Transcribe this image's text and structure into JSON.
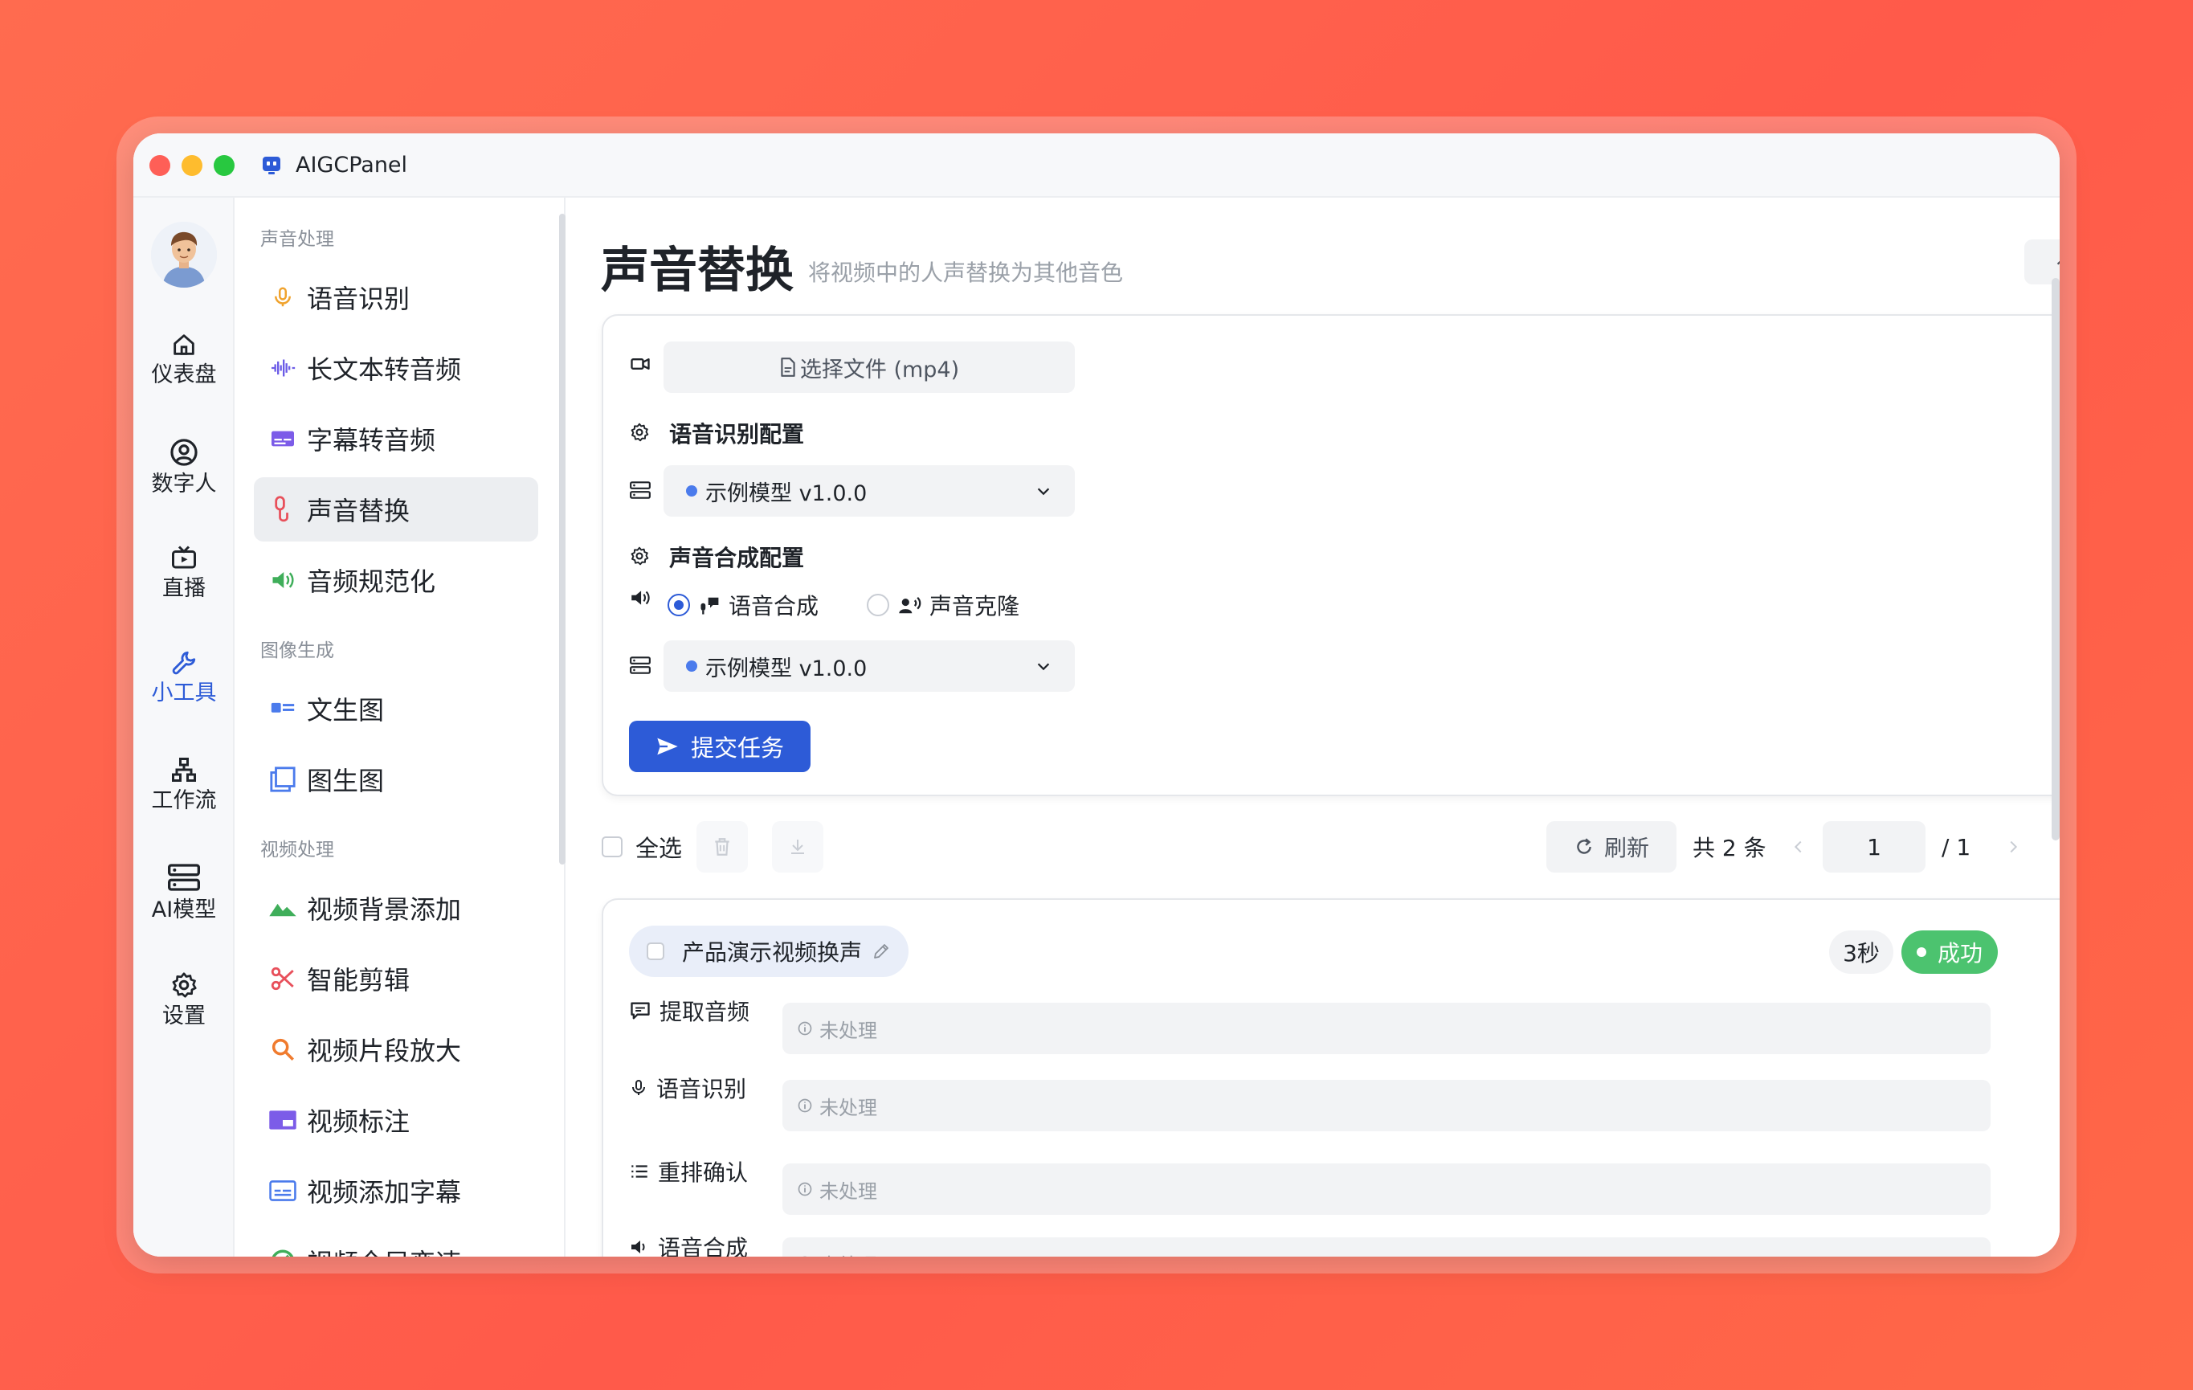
{
  "window": {
    "title": "AIGCPanel"
  },
  "leftnav": {
    "items": [
      {
        "label": "仪表盘",
        "icon": "home-icon"
      },
      {
        "label": "数字人",
        "icon": "user-circle-icon"
      },
      {
        "label": "直播",
        "icon": "tv-icon"
      },
      {
        "label": "小工具",
        "icon": "wrench-icon",
        "active": true
      },
      {
        "label": "工作流",
        "icon": "workflow-icon"
      },
      {
        "label": "AI模型",
        "icon": "server-icon"
      },
      {
        "label": "设置",
        "icon": "gear-icon"
      }
    ]
  },
  "sidemenu": {
    "sections": [
      {
        "title": "声音处理",
        "items": [
          "语音识别",
          "长文本转音频",
          "字幕转音频",
          "声音替换",
          "音频规范化"
        ]
      },
      {
        "title": "图像生成",
        "items": [
          "文生图",
          "图生图"
        ]
      },
      {
        "title": "视频处理",
        "items": [
          "视频背景添加",
          "智能剪辑",
          "视频片段放大",
          "视频标注",
          "视频添加字幕",
          "视频全局变速"
        ]
      }
    ],
    "active": "声音替换"
  },
  "page": {
    "title": "声音替换",
    "subtitle": "将视频中的人声替换为其他音色",
    "help_label": "说明"
  },
  "form": {
    "file_button": "选择文件 (mp4)",
    "asr_config_title": "语音识别配置",
    "asr_model": "示例模型 v1.0.0",
    "tts_config_title": "声音合成配置",
    "tts_option_1": "语音合成",
    "tts_option_2": "声音克隆",
    "tts_selected": "语音合成",
    "tts_model": "示例模型 v1.0.0",
    "submit_label": "提交任务"
  },
  "toolbar": {
    "select_all": "全选",
    "refresh": "刷新",
    "total": "共 2 条",
    "page": "1",
    "page_total": "/  1"
  },
  "task": {
    "name": "产品演示视频换声",
    "duration": "3秒",
    "status": "成功",
    "steps": [
      {
        "label": "提取音频",
        "status": "未处理"
      },
      {
        "label": "语音识别",
        "status": "未处理"
      },
      {
        "label": "重排确认",
        "status": "未处理"
      },
      {
        "label": "语音合成",
        "status": "未处理"
      }
    ]
  },
  "colors": {
    "accent": "#2d5bd7",
    "success": "#4cc36f",
    "background": "#ff5f4b"
  }
}
